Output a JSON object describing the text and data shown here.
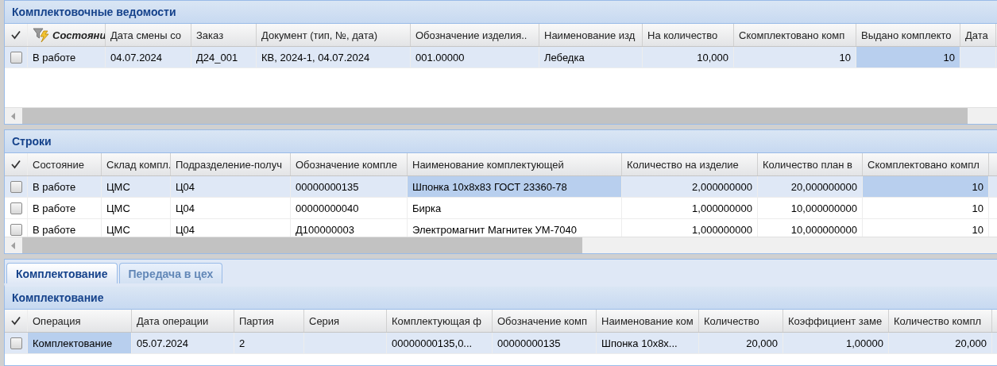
{
  "sheets_panel": {
    "title": "Комплектовочные ведомости",
    "columns": [
      {
        "label": "Состояни",
        "filtered": true,
        "numeric": false
      },
      {
        "label": "Дата смены со",
        "filtered": false,
        "numeric": false
      },
      {
        "label": "Заказ",
        "filtered": false,
        "numeric": false
      },
      {
        "label": "Документ (тип, №, дата)",
        "filtered": false,
        "numeric": false
      },
      {
        "label": "Обозначение изделия..",
        "filtered": false,
        "numeric": false
      },
      {
        "label": "Наименование изд",
        "filtered": false,
        "numeric": false
      },
      {
        "label": "На количество",
        "filtered": false,
        "numeric": true
      },
      {
        "label": "Скомплектовано комп",
        "filtered": false,
        "numeric": true
      },
      {
        "label": "Выдано комплекто",
        "filtered": false,
        "numeric": true
      },
      {
        "label": "Дата",
        "filtered": false
      }
    ],
    "rows": [
      {
        "checked": false,
        "selected": true,
        "cells": [
          {
            "text": "В работе",
            "focused": false
          },
          {
            "text": "04.07.2024",
            "focused": false
          },
          {
            "text": "Д24_001",
            "focused": false
          },
          {
            "text": "КВ, 2024-1, 04.07.2024",
            "focused": false
          },
          {
            "text": "001.00000",
            "focused": false
          },
          {
            "text": "Лебедка",
            "focused": false
          },
          {
            "text": "10,000",
            "focused": false
          },
          {
            "text": "10",
            "focused": false
          },
          {
            "text": "10",
            "focused": true
          },
          {
            "text": "",
            "focused": false
          }
        ]
      }
    ]
  },
  "lines_panel": {
    "title": "Строки",
    "columns": [
      {
        "label": "Состояние",
        "filtered": false,
        "numeric": false
      },
      {
        "label": "Склад компл.",
        "filtered": false,
        "numeric": false
      },
      {
        "label": "Подразделение-получ",
        "filtered": false,
        "numeric": false
      },
      {
        "label": "Обозначение компле",
        "filtered": false,
        "numeric": false
      },
      {
        "label": "Наименование комплектующей",
        "filtered": false,
        "numeric": false
      },
      {
        "label": "Количество на изделие",
        "filtered": false,
        "numeric": true
      },
      {
        "label": "Количество план в",
        "filtered": false,
        "numeric": true
      },
      {
        "label": "Скомплектовано компл",
        "filtered": false,
        "numeric": true
      }
    ],
    "rows": [
      {
        "checked": false,
        "selected": true,
        "cells": [
          {
            "text": "В работе",
            "focused": false
          },
          {
            "text": "ЦМС",
            "focused": false
          },
          {
            "text": "Ц04",
            "focused": false
          },
          {
            "text": "00000000135",
            "focused": false
          },
          {
            "text": "Шпонка 10x8x83 ГОСТ 23360-78",
            "focused": true
          },
          {
            "text": "2,000000000",
            "focused": false
          },
          {
            "text": "20,000000000",
            "focused": false
          },
          {
            "text": "10",
            "focused": true
          }
        ]
      },
      {
        "checked": false,
        "selected": false,
        "cells": [
          {
            "text": "В работе",
            "focused": false
          },
          {
            "text": "ЦМС",
            "focused": false
          },
          {
            "text": "Ц04",
            "focused": false
          },
          {
            "text": "00000000040",
            "focused": false
          },
          {
            "text": "Бирка",
            "focused": false
          },
          {
            "text": "1,000000000",
            "focused": false
          },
          {
            "text": "10,000000000",
            "focused": false
          },
          {
            "text": "10",
            "focused": false
          }
        ]
      },
      {
        "checked": false,
        "selected": false,
        "cells": [
          {
            "text": "В работе",
            "focused": false
          },
          {
            "text": "ЦМС",
            "focused": false
          },
          {
            "text": "Ц04",
            "focused": false
          },
          {
            "text": "Д100000003",
            "focused": false
          },
          {
            "text": "Электромагнит Магнитек УМ-7040",
            "focused": false
          },
          {
            "text": "1,000000000",
            "focused": false
          },
          {
            "text": "10,000000000",
            "focused": false
          },
          {
            "text": "10",
            "focused": false
          }
        ]
      }
    ]
  },
  "tabs": [
    {
      "label": "Комплектование",
      "selected": true
    },
    {
      "label": "Передача в цех",
      "selected": false
    }
  ],
  "assembly_panel": {
    "title": "Комплектование",
    "columns": [
      {
        "label": "Операция",
        "filtered": false,
        "numeric": false
      },
      {
        "label": "Дата операции",
        "filtered": false,
        "numeric": false
      },
      {
        "label": "Партия",
        "filtered": false,
        "numeric": false
      },
      {
        "label": "Серия",
        "filtered": false
      },
      {
        "label": "Комплектующая ф",
        "filtered": false,
        "numeric": false
      },
      {
        "label": "Обозначение комп",
        "filtered": false,
        "numeric": false
      },
      {
        "label": "Наименование ком",
        "filtered": false,
        "numeric": false
      },
      {
        "label": "Количество",
        "filtered": false,
        "numeric": true
      },
      {
        "label": "Коэффициент заме",
        "filtered": false,
        "numeric": true
      },
      {
        "label": "Количество компл",
        "filtered": false,
        "numeric": true
      }
    ],
    "rows": [
      {
        "checked": false,
        "selected": true,
        "cells": [
          {
            "text": "Комплектование",
            "focused": true
          },
          {
            "text": "05.07.2024",
            "focused": false
          },
          {
            "text": "2",
            "focused": false
          },
          {
            "text": "",
            "focused": false
          },
          {
            "text": "00000000135,0...",
            "focused": false
          },
          {
            "text": "00000000135",
            "focused": false
          },
          {
            "text": "Шпонка 10x8x...",
            "focused": false
          },
          {
            "text": "20,000",
            "focused": false
          },
          {
            "text": "1,00000",
            "focused": false
          },
          {
            "text": "20,000",
            "focused": false
          }
        ]
      }
    ]
  }
}
